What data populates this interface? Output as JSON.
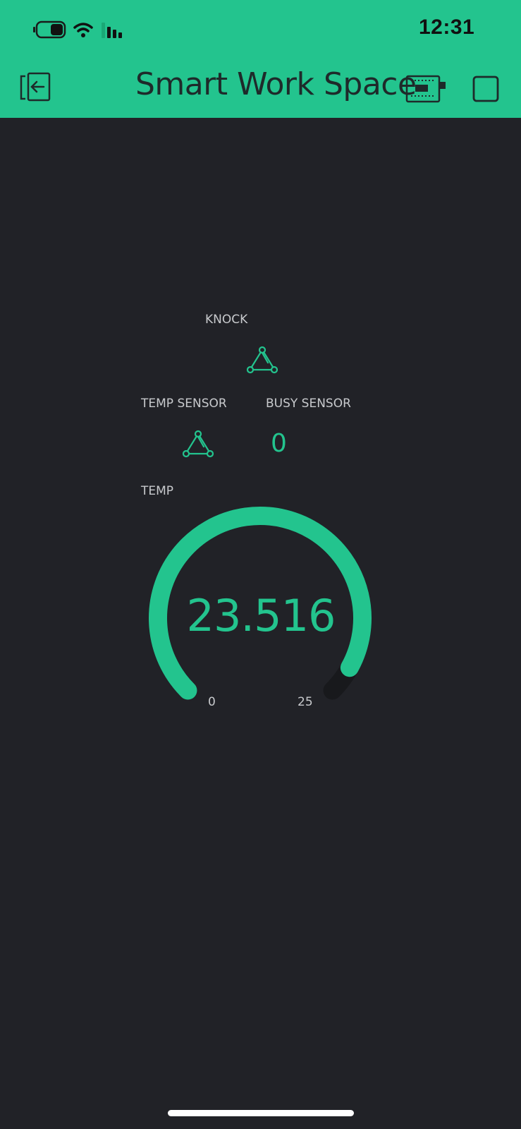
{
  "status_bar": {
    "time": "12:31",
    "icons": [
      "battery-icon",
      "wifi-icon",
      "signal-icon"
    ]
  },
  "header": {
    "title": "Smart Work Space",
    "left_icon": "exit-icon",
    "right_icons": [
      "device-icon",
      "stop-square-icon"
    ],
    "background": "#23c48e"
  },
  "widgets": {
    "knock": {
      "label": "KNOCK",
      "icon": "webhook-icon"
    },
    "temp_sensor": {
      "label": "TEMP SENSOR",
      "icon": "webhook-icon"
    },
    "busy_sensor": {
      "label": "BUSY SENSOR",
      "value": "0"
    },
    "temp_gauge": {
      "label": "TEMP",
      "value": "23.516",
      "min": "0",
      "max": "25",
      "level": 0.9406
    }
  },
  "colors": {
    "accent": "#23c48e",
    "background": "#212227",
    "label": "#c8cacd"
  }
}
